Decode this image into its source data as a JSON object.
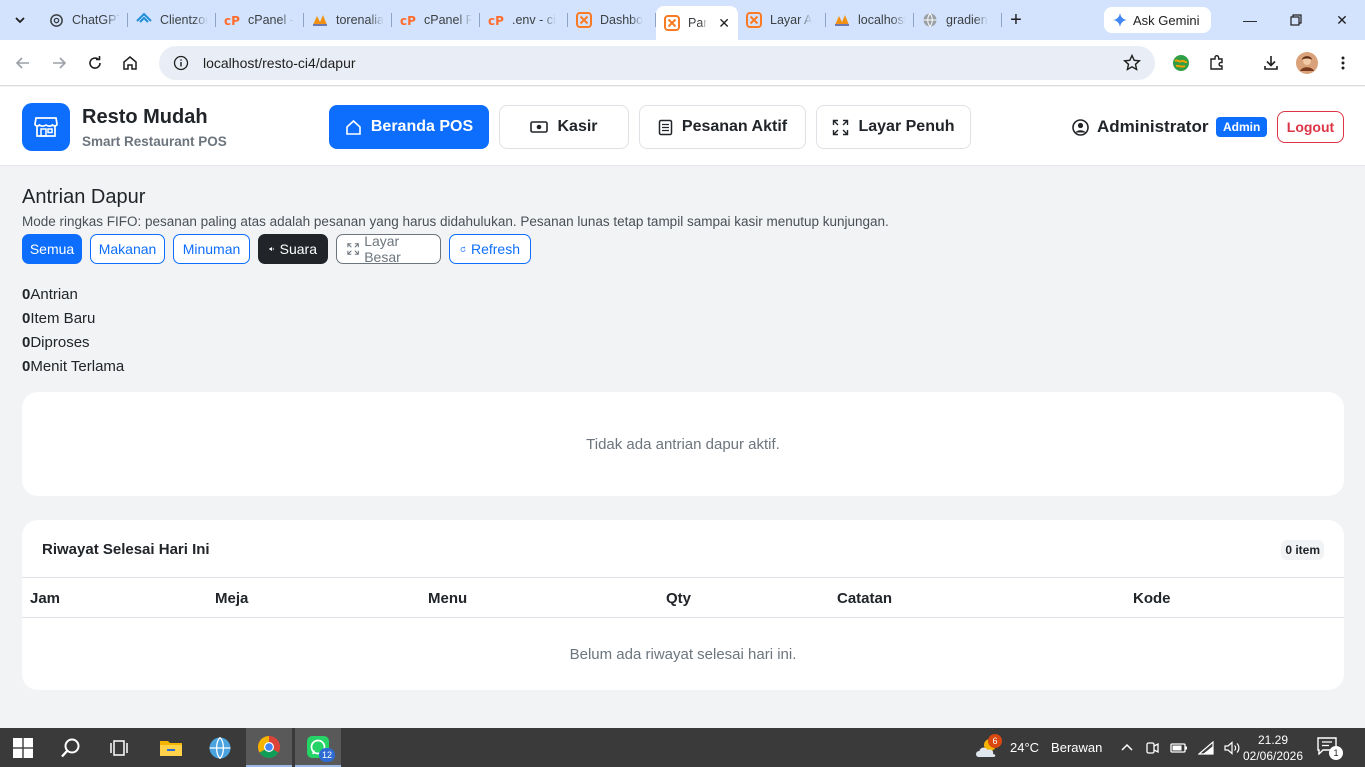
{
  "browser": {
    "tabs": [
      {
        "title": "ChatGPT",
        "icon": "chatgpt-icon"
      },
      {
        "title": "Clientzone",
        "icon": "clientzone-icon"
      },
      {
        "title": "cPanel -",
        "icon": "cpanel-icon"
      },
      {
        "title": "torenalia",
        "icon": "phpmyadmin-icon"
      },
      {
        "title": "cPanel F",
        "icon": "cpanel-icon"
      },
      {
        "title": ".env - ci",
        "icon": "cpanel-icon"
      },
      {
        "title": "Dashbo",
        "icon": "xampp-icon"
      },
      {
        "title": "Par",
        "icon": "xampp-icon",
        "active": true
      },
      {
        "title": "Layar A",
        "icon": "xampp-icon"
      },
      {
        "title": "localhost",
        "icon": "phpmyadmin-icon"
      },
      {
        "title": "gradien",
        "icon": "globe-icon"
      }
    ],
    "gemini_label": "Ask Gemini",
    "url": "localhost/resto-ci4/dapur"
  },
  "app": {
    "brand_name": "Resto Mudah",
    "brand_sub": "Smart Restaurant POS",
    "nav": {
      "home": "Beranda POS",
      "cashier": "Kasir",
      "orders": "Pesanan Aktif",
      "fullscreen": "Layar Penuh"
    },
    "user_name": "Administrator",
    "role_badge": "Admin",
    "logout_label": "Logout"
  },
  "page": {
    "title": "Antrian Dapur",
    "description": "Mode ringkas FIFO: pesanan paling atas adalah pesanan yang harus didahulukan. Pesanan lunas tetap tampil sampai kasir menutup kunjungan.",
    "filters": {
      "all": "Semua",
      "food": "Makanan",
      "drink": "Minuman",
      "sound": "Suara",
      "big_screen": "Layar Besar",
      "refresh": "Refresh"
    },
    "stats": [
      {
        "value": "0",
        "label": "Antrian"
      },
      {
        "value": "0",
        "label": "Item Baru"
      },
      {
        "value": "0",
        "label": "Diproses"
      },
      {
        "value": "0",
        "label": "Menit Terlama"
      }
    ],
    "queue_empty": "Tidak ada antrian dapur aktif.",
    "history": {
      "title": "Riwayat Selesai Hari Ini",
      "count": "0 item",
      "columns": [
        "Jam",
        "Meja",
        "Menu",
        "Qty",
        "Catatan",
        "Kode"
      ],
      "empty": "Belum ada riwayat selesai hari ini."
    }
  },
  "taskbar": {
    "whatsapp_badge": "12",
    "weather_badge": "6",
    "weather_temp": "24°C",
    "weather_desc": "Berawan",
    "time": "21.29",
    "date": "02/06/2026",
    "notif_count": "1"
  },
  "colors": {
    "primary": "#0d6efd",
    "danger": "#dc3545",
    "dark": "#212529",
    "tabstrip": "#d3e3fd"
  }
}
